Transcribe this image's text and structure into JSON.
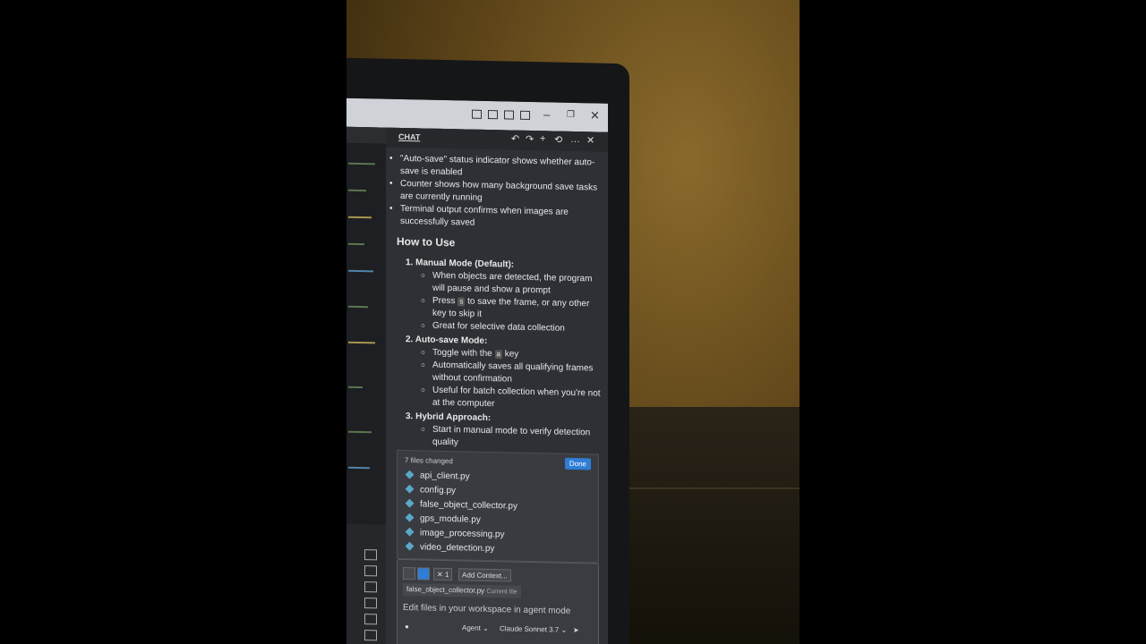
{
  "colors": {
    "accent": "#2f7dd6",
    "chat_bg": "#2e3035",
    "wall": "#8a6a2c"
  },
  "chat": {
    "tab_label": "CHAT",
    "header_icons": [
      "undo-icon",
      "redo-icon",
      "plus-icon",
      "history-icon",
      "more-icon",
      "close-icon"
    ],
    "bullets": [
      "\"Auto-save\" status indicator shows whether auto-save is enabled",
      "Counter shows how many background save tasks are currently running",
      "Terminal output confirms when images are successfully saved"
    ],
    "howto_heading": "How to Use",
    "steps": [
      {
        "title": "1. Manual Mode (Default):",
        "items": [
          "When objects are detected, the program will pause and show a prompt",
          "to save the frame, or any other key to skip it",
          "Great for selective data collection"
        ],
        "press_word": "Press",
        "key": "s"
      },
      {
        "title": "2. Auto-save Mode:",
        "items": [
          "Toggle with the",
          "key",
          "Automatically saves all qualifying frames without confirmation",
          "Useful for batch collection when you're not at the computer"
        ],
        "key": "a"
      },
      {
        "title": "3. Hybrid Approach:",
        "items": [
          "Start in manual mode to verify detection quality"
        ]
      }
    ],
    "changes": {
      "count_label": "7 files changed",
      "done_label": "Done",
      "files": [
        "api_client.py",
        "config.py",
        "false_object_collector.py",
        "gps_module.py",
        "image_processing.py",
        "video_detection.py"
      ]
    },
    "input": {
      "add_context": "Add Context...",
      "tools_count": "1",
      "current_file": "false_object_collector.py",
      "current_file_tag": "Current file",
      "placeholder": "Edit files in your workspace in agent mode",
      "mode": "Agent",
      "model": "Claude Sonnet 3.7"
    }
  }
}
